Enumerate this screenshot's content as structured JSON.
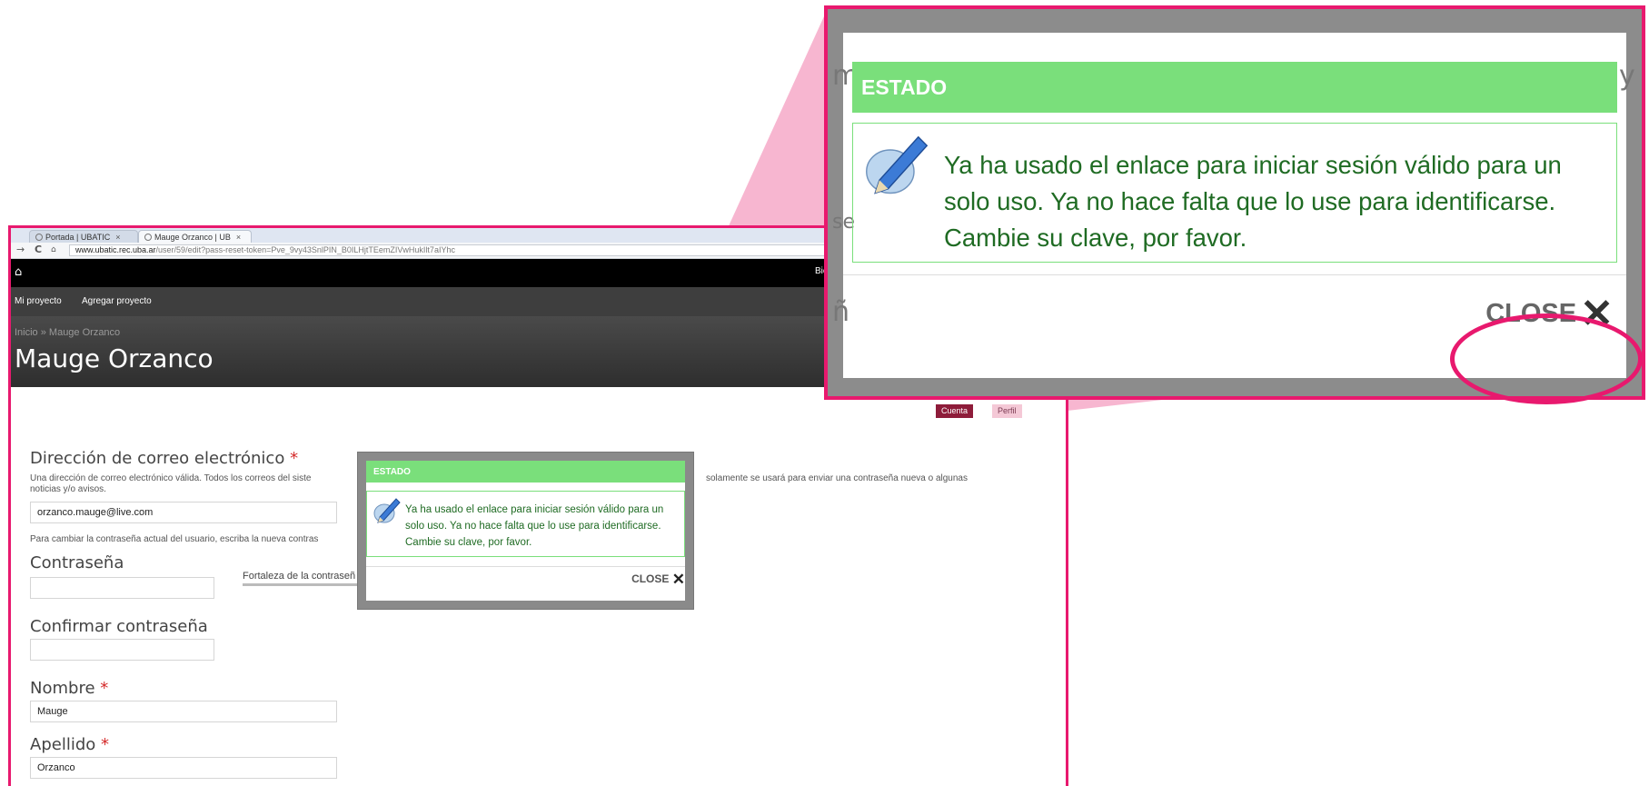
{
  "browser": {
    "tabs": [
      {
        "label": "Portada | UBATIC",
        "close": "×"
      },
      {
        "label": "Mauge Orzanco | UB",
        "close": "×"
      }
    ],
    "back_icon": "→",
    "reload_icon": "C",
    "home_icon": "🏠",
    "url_host": "www.ubatic.rec.uba.ar",
    "url_path": "/user/59/edit?pass-reset-token=Pve_9vy43SnlPIN_B0ILHjtTEemZIVwHukIlt7aIYhc"
  },
  "topnav": {
    "home_icon": "⌂",
    "right_text": "Bie"
  },
  "subnav": {
    "items": [
      "Mi proyecto",
      "Agregar proyecto"
    ]
  },
  "hero": {
    "breadcrumb": "Inicio » Mauge Orzanco",
    "title": "Mauge Orzanco"
  },
  "page_tabs": {
    "cuenta": "Cuenta",
    "perfil": "Perfil"
  },
  "form": {
    "email_label": "Dirección de correo electrónico",
    "required_mark": "*",
    "email_desc_left": "Una dirección de correo electrónico válida. Todos los correos del siste",
    "email_desc_right": "solamente se usará para enviar una contraseña nueva o algunas",
    "email_desc_line2": "noticias y/o avisos.",
    "email_value": "orzanco.mauge@live.com",
    "password_hint": "Para cambiar la contraseña actual del usuario, escriba la nueva contras",
    "password_label": "Contraseña",
    "strength_label": "Fortaleza de la contraseñ",
    "confirm_label": "Confirmar contraseña",
    "nombre_label": "Nombre",
    "nombre_value": "Mauge",
    "apellido_label": "Apellido",
    "apellido_value": "Orzanco"
  },
  "modal": {
    "header": "ESTADO",
    "message": "Ya ha usado el enlace para iniciar sesión válido para un solo uso. Ya no hace falta que lo use para identificarse. Cambie su clave, por favor.",
    "close_label": "CLOSE",
    "close_icon": "✕",
    "status_icon": "pen-icon"
  },
  "zoom_ghost": {
    "left1": "m",
    "right1": "y",
    "left2": "se",
    "left3": "ñ"
  },
  "colors": {
    "accent": "#e8196e",
    "status_green": "#7adf7b",
    "message_green": "#1f6b23",
    "funnel": "#f6a9c8"
  }
}
